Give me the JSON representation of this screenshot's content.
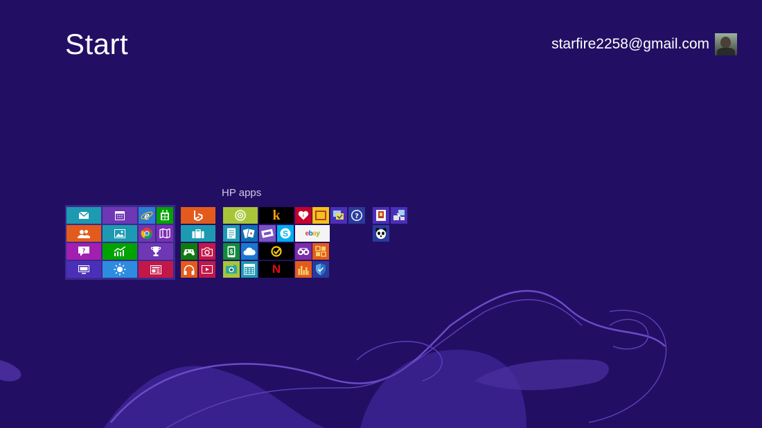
{
  "start": {
    "title": "Start"
  },
  "account": {
    "email": "starfire2258@gmail.com"
  },
  "groups": [
    {
      "label": ""
    },
    {
      "label": ""
    },
    {
      "label": "HP apps"
    },
    {
      "label": ""
    }
  ],
  "tiles": {
    "mail": {
      "icon": "mail-icon",
      "color": "#1d9ab1"
    },
    "calendar": {
      "icon": "calendar-icon",
      "color": "#6e37b4"
    },
    "internet_explorer": {
      "icon": "internet-explorer-icon",
      "color": "#2b7cd3"
    },
    "store": {
      "icon": "store-icon",
      "color": "#00a300"
    },
    "people": {
      "icon": "people-icon",
      "color": "#e35b1c"
    },
    "photos": {
      "icon": "photos-icon",
      "color": "#1d9ab1"
    },
    "chrome": {
      "icon": "chrome-icon",
      "color": "#6e37b4"
    },
    "maps": {
      "icon": "maps-icon",
      "color": "#7b2fb4"
    },
    "help_tips": {
      "icon": "help-tips-icon",
      "color": "#a21fb0"
    },
    "finance": {
      "icon": "finance-icon",
      "color": "#00a300"
    },
    "sports": {
      "icon": "sports-trophy-icon",
      "color": "#6e37b4"
    },
    "desktop": {
      "icon": "desktop-icon",
      "color": "#4b2fb8"
    },
    "weather": {
      "icon": "weather-icon",
      "color": "#2d8ce0"
    },
    "news": {
      "icon": "news-icon",
      "color": "#c3174a"
    },
    "bing": {
      "icon": "bing-icon",
      "color": "#e35b1c"
    },
    "travel": {
      "icon": "travel-icon",
      "color": "#1d9ab1"
    },
    "games": {
      "icon": "xbox-games-icon",
      "color": "#107c10"
    },
    "camera": {
      "icon": "camera-icon",
      "color": "#c3174a"
    },
    "music": {
      "icon": "headphones-icon",
      "color": "#e35b1c"
    },
    "video": {
      "icon": "video-icon",
      "color": "#c3174a"
    },
    "hp_connected": {
      "icon": "target-icon",
      "color": "#a8c53a"
    },
    "kindle": {
      "icon": "kindle-icon",
      "color": "#000000",
      "text": "k"
    },
    "iheartradio": {
      "icon": "iheartradio-icon",
      "color": "#c6002b"
    },
    "tile_yellow": {
      "icon": "slate-icon",
      "color": "#f0c419"
    },
    "hp_support": {
      "icon": "hp-support-icon",
      "color": "#4b2fb8"
    },
    "help": {
      "icon": "help-icon",
      "color": "#2a3a9c"
    },
    "notes": {
      "icon": "notes-icon",
      "color": "#1d9ab1"
    },
    "solitaire": {
      "icon": "cards-icon",
      "color": "#0e6fb4"
    },
    "tickets": {
      "icon": "ticket-icon",
      "color": "#7a52c4"
    },
    "skype": {
      "icon": "skype-icon",
      "color": "#00aff0"
    },
    "ebay": {
      "icon": "ebay-icon",
      "color": "#f4f4f4",
      "text": "ebay"
    },
    "money": {
      "icon": "phone-money-icon",
      "color": "#108a3c"
    },
    "onedrive": {
      "icon": "cloud-icon",
      "color": "#1977d2"
    },
    "norton": {
      "icon": "norton-icon",
      "color": "#000000"
    },
    "tripadvisor": {
      "icon": "tripadvisor-icon",
      "color": "#7a2da8"
    },
    "reader": {
      "icon": "reader-icon",
      "color": "#e35b1c"
    },
    "cyberlink": {
      "icon": "photo-edit-icon",
      "color": "#2da89a"
    },
    "calculator": {
      "icon": "calculator-icon",
      "color": "#1d9ab1"
    },
    "netflix": {
      "icon": "netflix-icon",
      "color": "#000000",
      "text": "N"
    },
    "audio": {
      "icon": "audio-bars-icon",
      "color": "#e35b1c"
    },
    "security": {
      "icon": "shield-icon",
      "color": "#2a3a9c"
    },
    "app_a": {
      "icon": "app-a-icon",
      "color": "#4b2fb8"
    },
    "app_b": {
      "icon": "app-b-icon",
      "color": "#4b2fb8"
    },
    "panda": {
      "icon": "panda-icon",
      "color": "#2a3a9c"
    }
  }
}
